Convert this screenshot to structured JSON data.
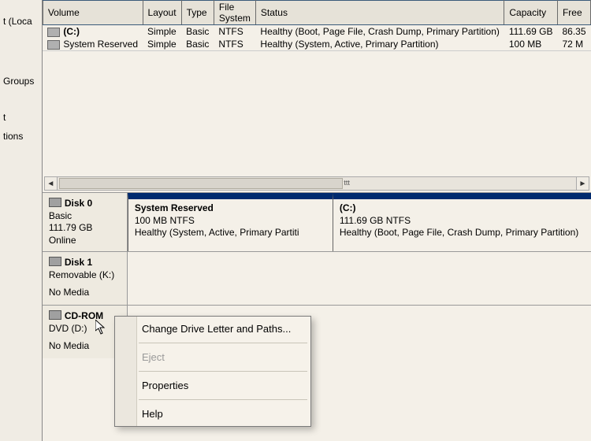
{
  "sidebar": {
    "items": [
      {
        "label": "t (Loca"
      },
      {
        "label": "Groups"
      },
      {
        "label": "t"
      },
      {
        "label": "tions"
      }
    ]
  },
  "columns": {
    "volume": "Volume",
    "layout": "Layout",
    "type": "Type",
    "filesystem": "File System",
    "status": "Status",
    "capacity": "Capacity",
    "free": "Free"
  },
  "volumes": [
    {
      "name": "(C:)",
      "layout": "Simple",
      "type": "Basic",
      "fs": "NTFS",
      "status": "Healthy (Boot, Page File, Crash Dump, Primary Partition)",
      "capacity": "111.69 GB",
      "free": "86.35"
    },
    {
      "name": "System Reserved",
      "layout": "Simple",
      "type": "Basic",
      "fs": "NTFS",
      "status": "Healthy (System, Active, Primary Partition)",
      "capacity": "100 MB",
      "free": "72 M"
    }
  ],
  "scroll": {
    "mark": "ttt"
  },
  "disks": [
    {
      "name": "Disk 0",
      "type": "Basic",
      "size": "111.79 GB",
      "state": "Online",
      "partitions": [
        {
          "title": "System Reserved",
          "sub": "100 MB NTFS",
          "status": "Healthy (System, Active, Primary Partiti"
        },
        {
          "title": "(C:)",
          "sub": "111.69 GB NTFS",
          "status": "Healthy (Boot, Page File, Crash Dump, Primary Partition)"
        }
      ]
    },
    {
      "name": "Disk 1",
      "type": "Removable (K:)",
      "size": "",
      "state": "No Media",
      "partitions": []
    },
    {
      "name": "CD-ROM",
      "type": "DVD (D:)",
      "size": "",
      "state": "No Media",
      "partitions": []
    }
  ],
  "context_menu": {
    "items": [
      {
        "label": "Change Drive Letter and Paths...",
        "enabled": true
      },
      {
        "label": "Eject",
        "enabled": false
      },
      {
        "label": "Properties",
        "enabled": true
      },
      {
        "label": "Help",
        "enabled": true
      }
    ]
  }
}
